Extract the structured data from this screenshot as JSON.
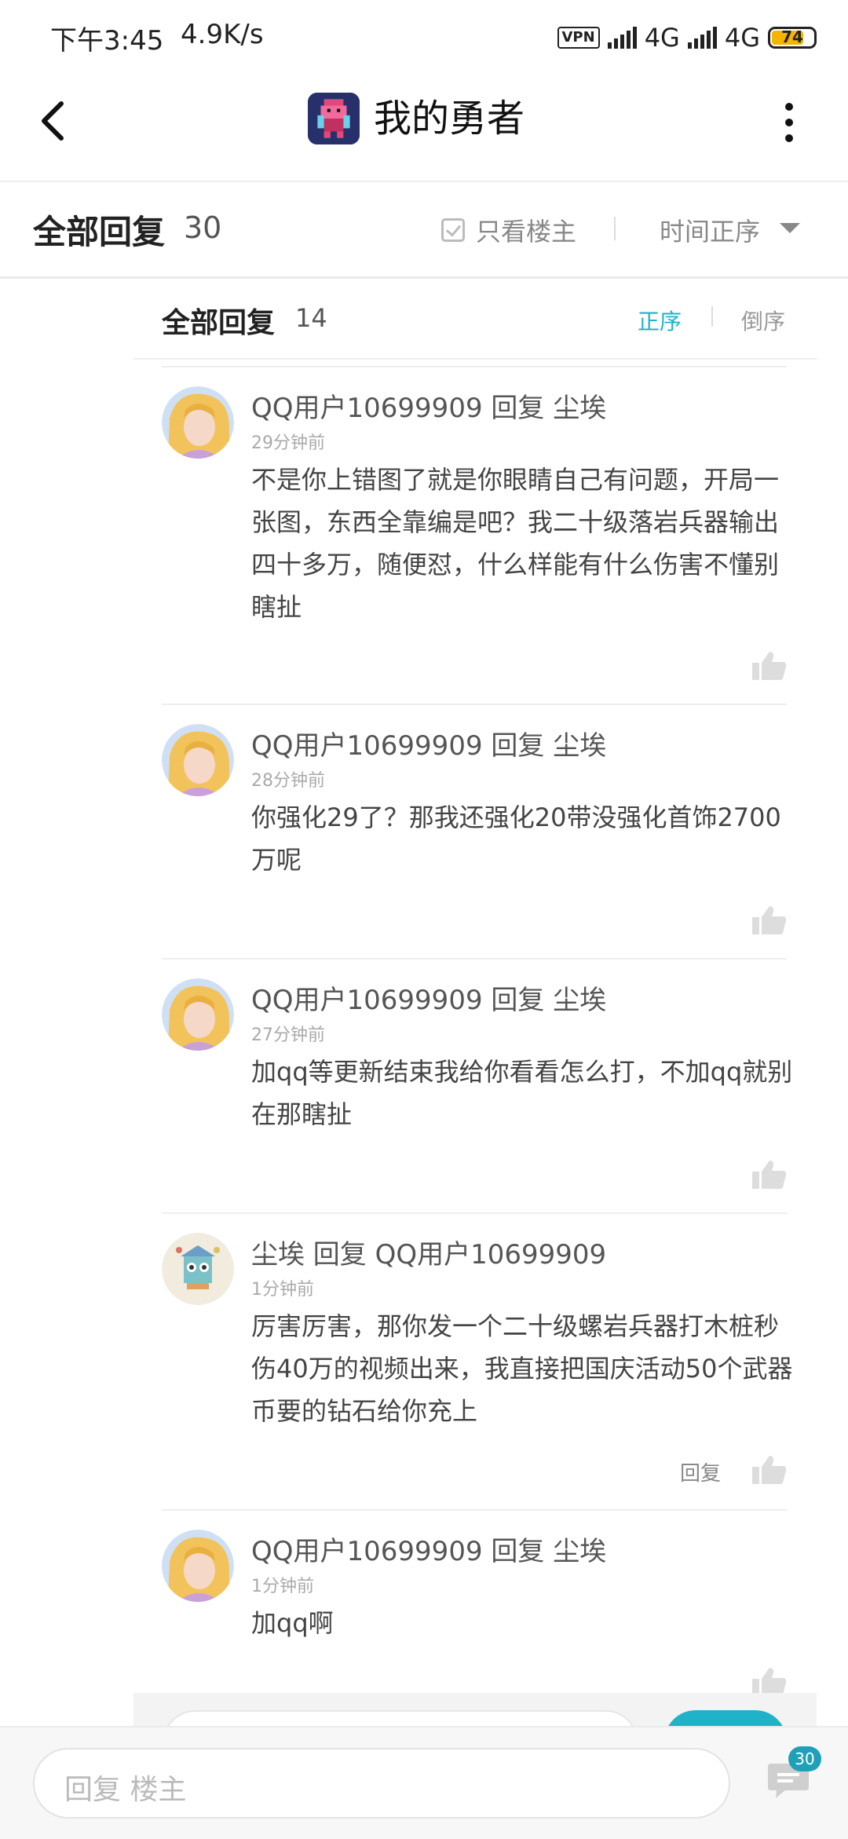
{
  "status": {
    "time": "下午3:45",
    "speed": "4.9K/s",
    "vpn": "VPN",
    "net1": "4G",
    "net2": "4G",
    "battery": "74"
  },
  "titlebar": {
    "title": "我的勇者"
  },
  "header": {
    "title": "全部回复",
    "count": "30",
    "only_owner": "只看楼主",
    "sort": "时间正序"
  },
  "sub": {
    "title": "全部回复",
    "count": "14",
    "asc": "正序",
    "desc": "倒序"
  },
  "comments": [
    {
      "user": "QQ用户10699909 回复 尘埃",
      "time": "29分钟前",
      "text": "不是你上错图了就是你眼睛自己有问题，开局一张图，东西全靠编是吧？我二十级落岩兵器输出四十多万，随便怼，什么样能有什么伤害不懂别瞎扯"
    },
    {
      "user": "QQ用户10699909 回复 尘埃",
      "time": "28分钟前",
      "text": "你强化29了？那我还强化20带没强化首饰2700万呢"
    },
    {
      "user": "QQ用户10699909 回复 尘埃",
      "time": "27分钟前",
      "text": "加qq等更新结束我给你看看怎么打，不加qq就别在那瞎扯"
    },
    {
      "user": "尘埃 回复 QQ用户10699909",
      "time": "1分钟前",
      "text": "厉害厉害，那你发一个二十级螺岩兵器打木桩秒伤40万的视频出来，我直接把国庆活动50个武器币要的钻石给你充上",
      "reply": "回复"
    },
    {
      "user": "QQ用户10699909 回复 尘埃",
      "time": "1分钟前",
      "text": "加qq啊"
    }
  ],
  "bottom": {
    "placeholder": "回复  楼主",
    "badge": "30"
  },
  "colors": {
    "accent": "#20b2c8"
  }
}
